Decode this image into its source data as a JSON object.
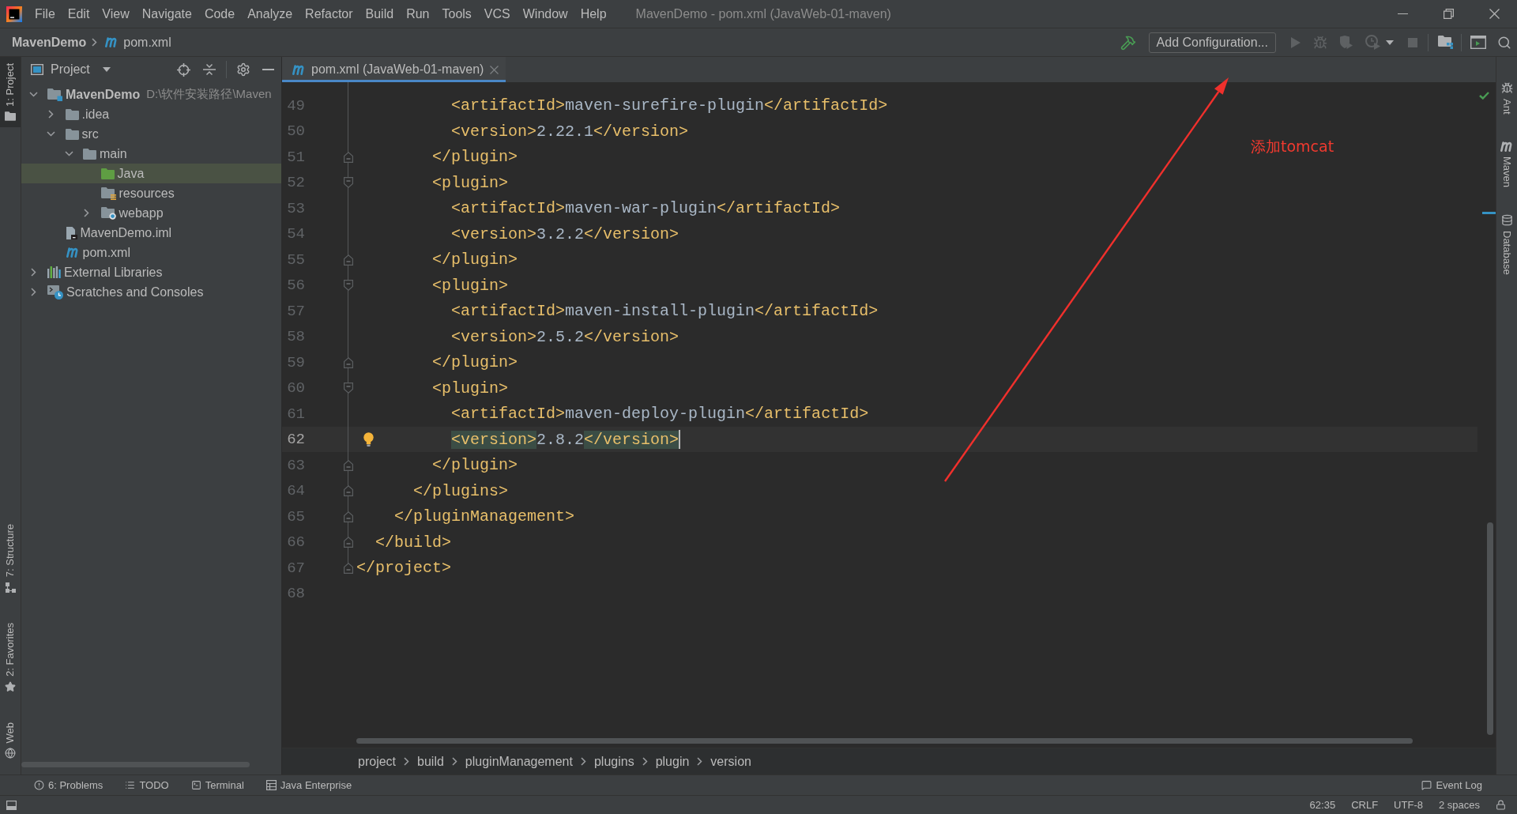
{
  "window": {
    "title": "MavenDemo - pom.xml (JavaWeb-01-maven)"
  },
  "menu": [
    "File",
    "Edit",
    "View",
    "Navigate",
    "Code",
    "Analyze",
    "Refactor",
    "Build",
    "Run",
    "Tools",
    "VCS",
    "Window",
    "Help"
  ],
  "nav_bar": {
    "crumbs": [
      {
        "label": "MavenDemo",
        "kind": "project"
      },
      {
        "label": "pom.xml",
        "kind": "maven-file"
      }
    ],
    "run_configuration": "Add Configuration..."
  },
  "left_stripe": {
    "top": [
      {
        "label": "1: Project",
        "kind": "project",
        "selected": true
      }
    ],
    "bottom": [
      {
        "label": "7: Structure",
        "kind": "structure",
        "selected": false
      },
      {
        "label": "2: Favorites",
        "kind": "favorites",
        "selected": false
      },
      {
        "label": "Web",
        "kind": "web",
        "selected": false
      }
    ]
  },
  "project_panel": {
    "title": "Project",
    "tree": [
      {
        "label": "MavenDemo",
        "kind": "module",
        "path": "D:\\软件安装路径\\Maven",
        "expanded": true,
        "selected": false,
        "children": [
          {
            "label": ".idea",
            "kind": "folder",
            "expanded": false,
            "selected": false
          },
          {
            "label": "src",
            "kind": "folder",
            "expanded": true,
            "selected": false,
            "children": [
              {
                "label": "main",
                "kind": "folder",
                "expanded": true,
                "selected": false,
                "children": [
                  {
                    "label": "Java",
                    "kind": "source-folder",
                    "selected": true
                  },
                  {
                    "label": "resources",
                    "kind": "resources-folder",
                    "selected": false
                  },
                  {
                    "label": "webapp",
                    "kind": "web-folder",
                    "expanded": false,
                    "selected": false
                  }
                ]
              }
            ]
          },
          {
            "label": "MavenDemo.iml",
            "kind": "iml-file",
            "selected": false
          },
          {
            "label": "pom.xml",
            "kind": "maven-file",
            "selected": false
          }
        ]
      },
      {
        "label": "External Libraries",
        "kind": "libraries",
        "expanded": false,
        "selected": false
      },
      {
        "label": "Scratches and Consoles",
        "kind": "scratches",
        "expanded": false,
        "selected": false
      }
    ]
  },
  "editor": {
    "tabs": [
      {
        "label": "pom.xml (JavaWeb-01-maven)",
        "kind": "maven-file",
        "selected": true
      }
    ],
    "lines": [
      {
        "number": "49",
        "text": "          <artifactId>maven-surefire-plugin</artifactId>",
        "kind": "plain",
        "current": false
      },
      {
        "number": "50",
        "text": "          <version>2.22.1</version>",
        "kind": "plain",
        "current": false
      },
      {
        "number": "51",
        "text": "        </plugin>",
        "kind": "fold-end",
        "current": false
      },
      {
        "number": "52",
        "text": "        <plugin>",
        "kind": "fold-start",
        "current": false
      },
      {
        "number": "53",
        "text": "          <artifactId>maven-war-plugin</artifactId>",
        "kind": "plain",
        "current": false
      },
      {
        "number": "54",
        "text": "          <version>3.2.2</version>",
        "kind": "plain",
        "current": false
      },
      {
        "number": "55",
        "text": "        </plugin>",
        "kind": "fold-end",
        "current": false
      },
      {
        "number": "56",
        "text": "        <plugin>",
        "kind": "fold-start",
        "current": false
      },
      {
        "number": "57",
        "text": "          <artifactId>maven-install-plugin</artifactId>",
        "kind": "plain",
        "current": false
      },
      {
        "number": "58",
        "text": "          <version>2.5.2</version>",
        "kind": "plain",
        "current": false
      },
      {
        "number": "59",
        "text": "        </plugin>",
        "kind": "fold-end",
        "current": false
      },
      {
        "number": "60",
        "text": "        <plugin>",
        "kind": "fold-start",
        "current": false
      },
      {
        "number": "61",
        "text": "          <artifactId>maven-deploy-plugin</artifactId>",
        "kind": "plain",
        "current": false
      },
      {
        "number": "62",
        "text": "          <version>2.8.2</version>",
        "kind": "bulb",
        "current": true
      },
      {
        "number": "63",
        "text": "        </plugin>",
        "kind": "fold-end",
        "current": false
      },
      {
        "number": "64",
        "text": "      </plugins>",
        "kind": "fold-end",
        "current": false
      },
      {
        "number": "65",
        "text": "    </pluginManagement>",
        "kind": "fold-end",
        "current": false
      },
      {
        "number": "66",
        "text": "  </build>",
        "kind": "fold-end",
        "current": false
      },
      {
        "number": "67",
        "text": "</project>",
        "kind": "fold-end",
        "current": false
      },
      {
        "number": "68",
        "kind": "plain",
        "current": false
      }
    ],
    "breadcrumbs": [
      "project",
      "build",
      "pluginManagement",
      "plugins",
      "plugin",
      "version"
    ]
  },
  "right_stripe": [
    {
      "label": "Ant",
      "kind": "ant"
    },
    {
      "label": "Maven",
      "kind": "maven"
    },
    {
      "label": "Database",
      "kind": "database"
    }
  ],
  "tool_stripe": {
    "left": [
      {
        "label": "6: Problems",
        "kind": "problems"
      },
      {
        "label": "TODO",
        "kind": "todo"
      },
      {
        "label": "Terminal",
        "kind": "terminal"
      },
      {
        "label": "Java Enterprise",
        "kind": "java-enterprise"
      }
    ],
    "right": [
      {
        "label": "Event Log",
        "kind": "event-log"
      }
    ]
  },
  "status_bar": {
    "items": [
      "62:35",
      "CRLF",
      "UTF-8",
      "2 spaces"
    ]
  },
  "annotation": {
    "text": "添加tomcat"
  }
}
